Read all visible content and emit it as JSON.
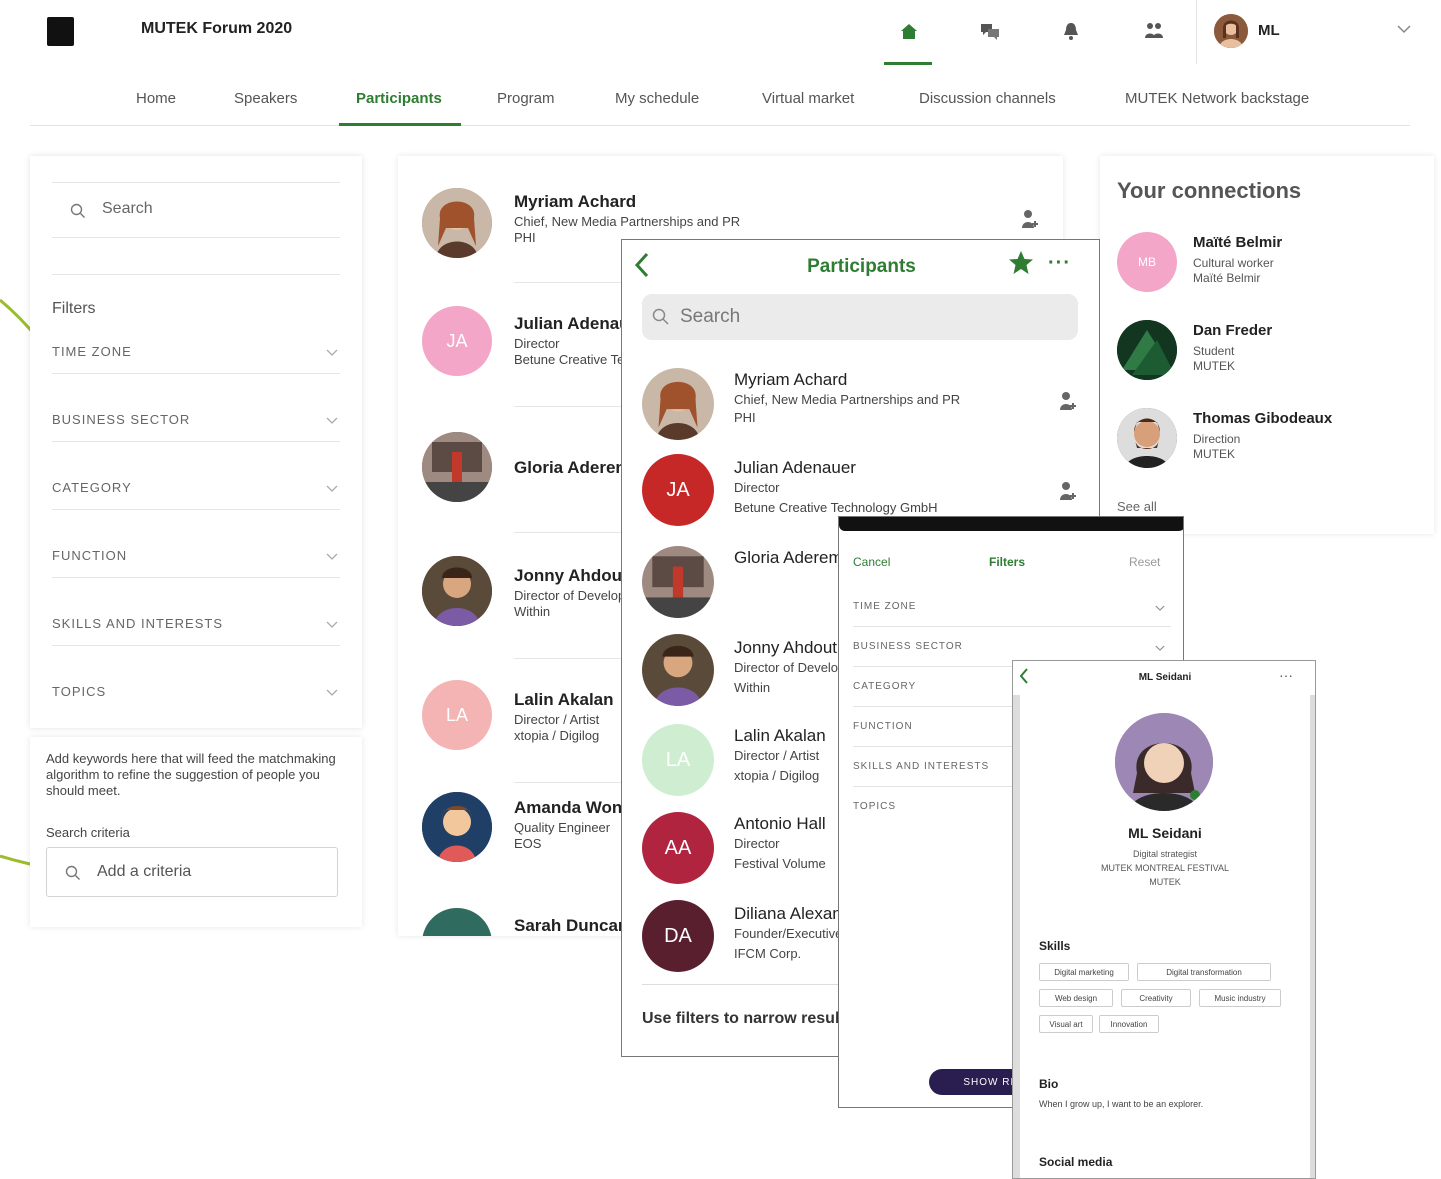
{
  "app": {
    "title": "MUTEK Forum 2020",
    "user_initials": "ML"
  },
  "nav": {
    "tabs": [
      {
        "label": "Home"
      },
      {
        "label": "Speakers"
      },
      {
        "label": "Participants"
      },
      {
        "label": "Program"
      },
      {
        "label": "My schedule"
      },
      {
        "label": "Virtual market"
      },
      {
        "label": "Discussion channels"
      },
      {
        "label": "MUTEK Network backstage"
      }
    ],
    "active": "Participants"
  },
  "sidebar": {
    "search_placeholder": "Search",
    "filters_title": "Filters",
    "filters": [
      {
        "label": "TIME ZONE"
      },
      {
        "label": "BUSINESS SECTOR"
      },
      {
        "label": "CATEGORY"
      },
      {
        "label": "FUNCTION"
      },
      {
        "label": "SKILLS AND INTERESTS"
      },
      {
        "label": "TOPICS"
      }
    ],
    "criteria_help": "Add keywords here that will feed the matchmaking algorithm to refine the suggestion of people you should meet.",
    "criteria_label": "Search criteria",
    "criteria_placeholder": "Add a criteria"
  },
  "participants": [
    {
      "name": "Myriam Achard",
      "line1": "Chief, New Media Partnerships and PR",
      "line2": "PHI",
      "initials": "",
      "color": "#a0705a"
    },
    {
      "name": "Julian Adenauer",
      "line1": "Director",
      "line2": "Betune Creative Technology GmbH",
      "initials": "JA",
      "color": "#f4a6c8"
    },
    {
      "name": "Gloria Aderemi",
      "line1": "",
      "line2": "",
      "initials": "",
      "color": "#7a5a52"
    },
    {
      "name": "Jonny Ahdout",
      "line1": "Director of Development",
      "line2": "Within",
      "initials": "",
      "color": "#6a4a3a"
    },
    {
      "name": "Lalin Akalan",
      "line1": "Director / Artist",
      "line2": "xtopia / Digilog",
      "initials": "LA",
      "color": "#f4b4b4"
    },
    {
      "name": "Amanda Wong",
      "line1": "Quality Engineer",
      "line2": "EOS",
      "initials": "",
      "color": "#3b5b7a"
    },
    {
      "name": "Sarah Duncan",
      "line1": "",
      "line2": "",
      "initials": "",
      "color": "#2f6b5e"
    }
  ],
  "connections": {
    "title": "Your connections",
    "items": [
      {
        "name": "Maïté Belmir",
        "line1": "Cultural worker",
        "line2": "Maïté Belmir",
        "initials": "MB",
        "color": "#f4a6c8"
      },
      {
        "name": "Dan Freder",
        "line1": "Student",
        "line2": "MUTEK",
        "initials": "",
        "color": "#1f4a2e"
      },
      {
        "name": "Thomas Gibodeaux",
        "line1": "Direction",
        "line2": "MUTEK",
        "initials": "",
        "color": "#6b4a35"
      }
    ],
    "see_all": "See all"
  },
  "mobile_list": {
    "title": "Participants",
    "search_placeholder": "Search",
    "items": [
      {
        "name": "Myriam Achard",
        "line1": "Chief, New Media Partnerships and PR",
        "line2": "PHI",
        "initials": "",
        "color": "#a0705a"
      },
      {
        "name": "Julian Adenauer",
        "line1": "Director",
        "line2": "Betune Creative Technology GmbH",
        "initials": "JA",
        "color": "#c62828"
      },
      {
        "name": "Gloria Aderemi",
        "line1": "",
        "line2": "",
        "initials": "",
        "color": "#7a5a52"
      },
      {
        "name": "Jonny Ahdout",
        "line1": "Director of Development",
        "line2": "Within",
        "initials": "",
        "color": "#6a4a3a"
      },
      {
        "name": "Lalin Akalan",
        "line1": "Director / Artist",
        "line2": "xtopia / Digilog",
        "initials": "LA",
        "color": "#cfeed1"
      },
      {
        "name": "Antonio Hall",
        "line1": "Director",
        "line2": "Festival Volume",
        "initials": "AA",
        "color": "#b0243f"
      },
      {
        "name": "Diliana Alexandrova",
        "line1": "Founder/Executive",
        "line2": "IFCM Corp.",
        "initials": "DA",
        "color": "#5a1f2e"
      }
    ],
    "footer": "Use filters to narrow results"
  },
  "mobile_filters": {
    "cancel": "Cancel",
    "title": "Filters",
    "reset": "Reset",
    "rows": [
      {
        "label": "TIME ZONE"
      },
      {
        "label": "BUSINESS SECTOR"
      },
      {
        "label": "CATEGORY"
      },
      {
        "label": "FUNCTION"
      },
      {
        "label": "SKILLS AND INTERESTS"
      },
      {
        "label": "TOPICS"
      }
    ],
    "show_button": "SHOW RESULTS"
  },
  "mobile_profile": {
    "title": "ML Seidani",
    "name": "ML Seidani",
    "meta": [
      "Digital strategist",
      "MUTEK MONTREAL FESTIVAL",
      "MUTEK"
    ],
    "skills_heading": "Skills",
    "skills": [
      "Digital marketing",
      "Digital transformation",
      "Web design",
      "Creativity",
      "Music industry",
      "Visual art",
      "Innovation"
    ],
    "bio_heading": "Bio",
    "bio": "When I grow up, I want to be an explorer.",
    "social_heading": "Social media"
  },
  "colors": {
    "accent": "#2e7d32",
    "annotation": "#9bbc2c",
    "dark_button": "#2a1d4f"
  }
}
